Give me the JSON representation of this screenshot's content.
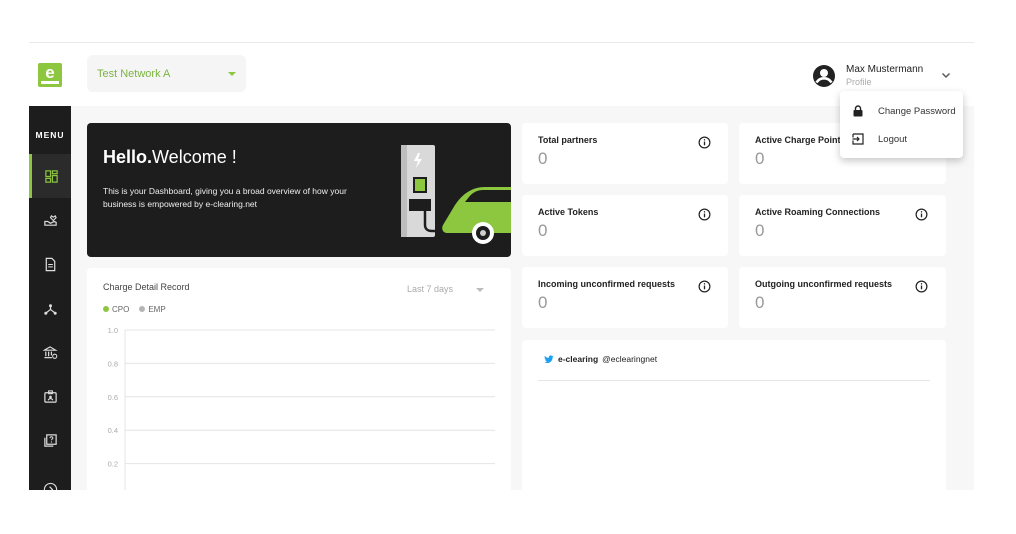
{
  "brand": {
    "color": "#8dc63f",
    "logo_letter": "e"
  },
  "header": {
    "network_select": {
      "value": "Test Network A"
    },
    "user": {
      "name": "Max Mustermann",
      "subtitle": "Profile"
    }
  },
  "user_menu": {
    "items": [
      {
        "label": "Change Password",
        "icon": "lock-icon"
      },
      {
        "label": "Logout",
        "icon": "logout-icon"
      }
    ]
  },
  "sidebar": {
    "menu_label": "MENU",
    "items": [
      {
        "name": "dashboard",
        "icon": "dashboard-icon",
        "active": true
      },
      {
        "name": "partners",
        "icon": "handshake-icon",
        "active": false
      },
      {
        "name": "documents",
        "icon": "document-icon",
        "active": false
      },
      {
        "name": "network",
        "icon": "network-icon",
        "active": false
      },
      {
        "name": "clearing",
        "icon": "bank-icon",
        "active": false
      },
      {
        "name": "profile",
        "icon": "id-card-icon",
        "active": false
      },
      {
        "name": "help",
        "icon": "help-icon",
        "active": false
      },
      {
        "name": "more",
        "icon": "arrow-icon",
        "active": false
      }
    ]
  },
  "welcome": {
    "title_bold": "Hello.",
    "title_rest": "Welcome !",
    "text": "This is your Dashboard, giving you a broad overview of how your business is empowered by e-clearing.net"
  },
  "stats": [
    {
      "title": "Total partners",
      "value": "0"
    },
    {
      "title": "Active Charge Points",
      "value": "0"
    },
    {
      "title": "Active Tokens",
      "value": "0"
    },
    {
      "title": "Active Roaming Connections",
      "value": "0"
    },
    {
      "title": "Incoming unconfirmed requests",
      "value": "0"
    },
    {
      "title": "Outgoing unconfirmed requests",
      "value": "0"
    }
  ],
  "cdr_chart": {
    "title": "Charge Detail Record",
    "range": "Last 7 days",
    "legend": [
      {
        "label": "CPO",
        "color": "#8dc63f"
      },
      {
        "label": "EMP",
        "color": "#b5b5b5"
      }
    ]
  },
  "chart_data": {
    "type": "line",
    "title": "Charge Detail Record",
    "series": [
      {
        "name": "CPO",
        "values": []
      },
      {
        "name": "EMP",
        "values": []
      }
    ],
    "ylim": [
      0,
      1.0
    ],
    "yticks": [
      "1.0",
      "0.8",
      "0.6",
      "0.4",
      "0.2"
    ],
    "grid": true,
    "legend_position": "top-left"
  },
  "twitter": {
    "name": "e-clearing",
    "handle": "@eclearingnet"
  }
}
